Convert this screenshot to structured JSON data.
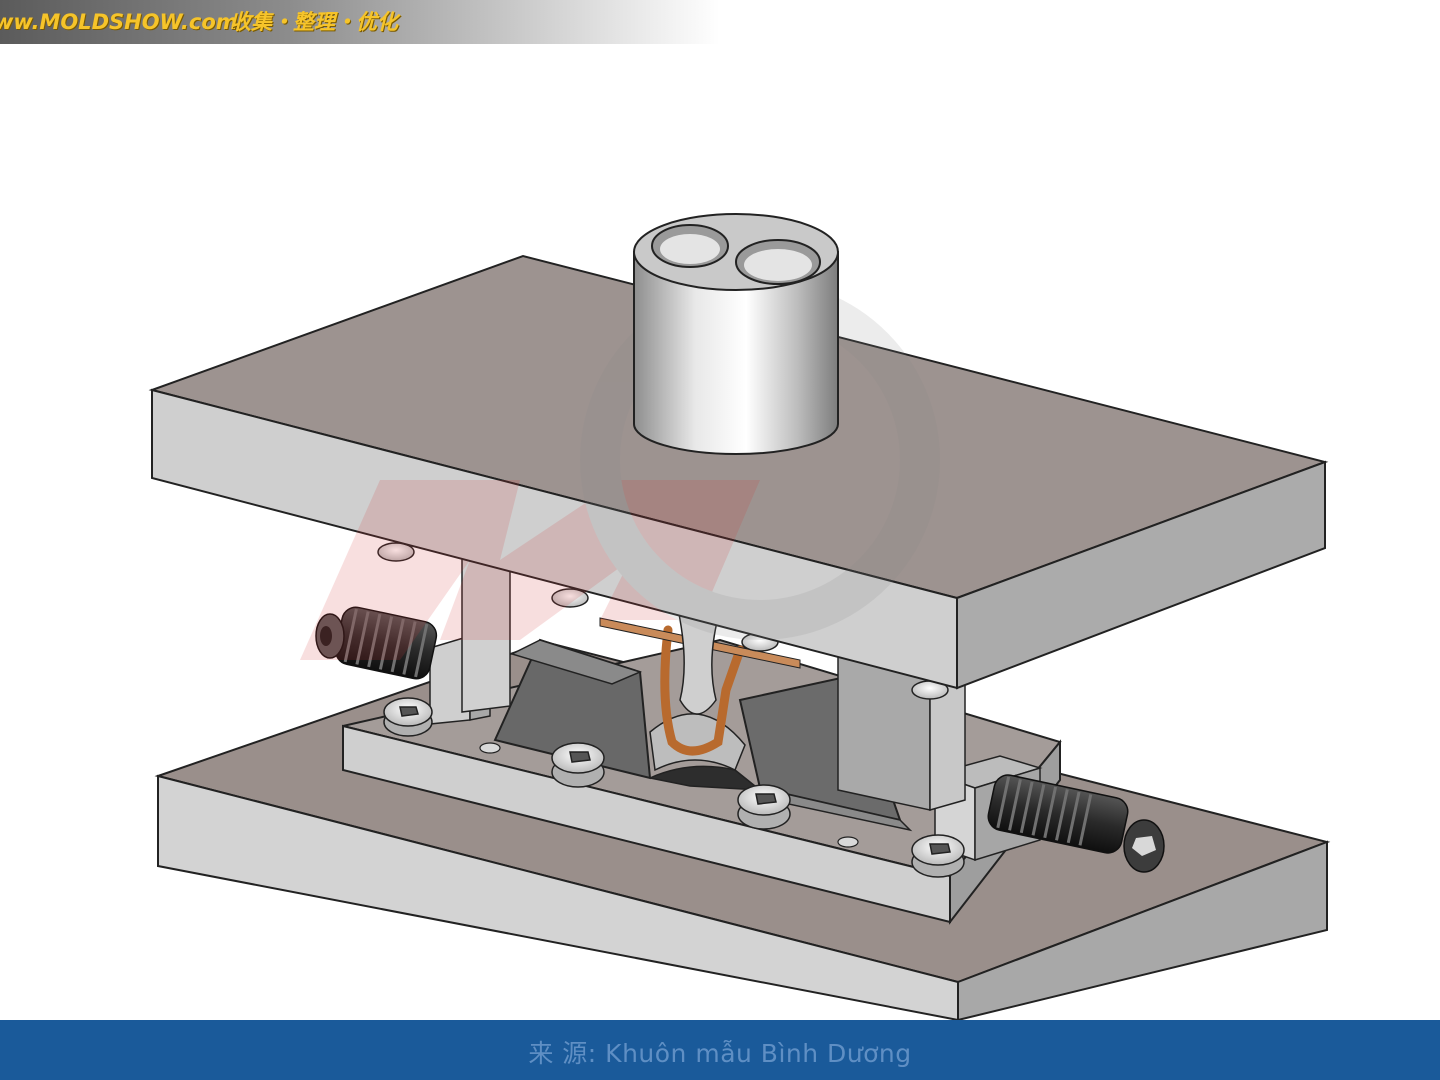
{
  "header": {
    "site": "ww.MOLDSHOW.com",
    "slogan": "收集・整理・优化",
    "accent_color": "#f6c42a"
  },
  "scene": {
    "icons": [
      "mold-assembly-3d",
      "watermark-logo"
    ]
  },
  "footer": {
    "source_label": "来 源:",
    "source_name": "Khuôn mẫu Bình Dương",
    "bar_color": "#1a5a9a",
    "text_color": "#5f8fc4"
  }
}
